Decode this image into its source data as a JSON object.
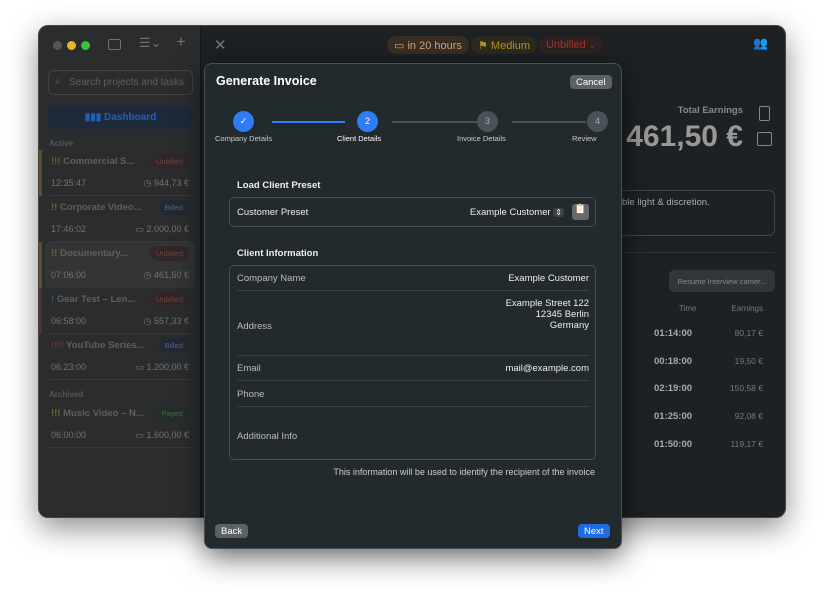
{
  "sidebar": {
    "search_placeholder": "Search projects and tasks",
    "dashboard_label": "Dashboard",
    "active_label": "Active",
    "archived_label": "Archived",
    "items": [
      {
        "priority": "!!!",
        "title": "Commercial S...",
        "status": "Unbilled",
        "time": "12:35:47",
        "amount": "944,73 €",
        "accent": "#8a6d1f"
      },
      {
        "priority": "!!",
        "title": "Corporate Video...",
        "status": "Billed",
        "time": "17:46:02",
        "amount": "2.000,00 €",
        "accent": ""
      },
      {
        "priority": "!!",
        "title": "Documentary...",
        "status": "Unbilled",
        "time": "07:06:00",
        "amount": "461,50 €",
        "accent": "#8a6d1f"
      },
      {
        "priority": "!",
        "title": "Gear Test – Len...",
        "status": "Unbilled",
        "time": "06:58:00",
        "amount": "557,33 €",
        "accent": "#8a2a2a"
      },
      {
        "priority": "!!!!",
        "title": "YouTube Series...",
        "status": "Billed",
        "time": "06:23:00",
        "amount": "1.200,00 €",
        "accent": ""
      }
    ],
    "archived": [
      {
        "priority": "!!!",
        "title": "Music Video – N...",
        "status": "Payed",
        "time": "06:00:00",
        "amount": "1.600,00 €"
      }
    ]
  },
  "header": {
    "due": "in 20 hours",
    "priority": "Medium",
    "status": "Unbilled"
  },
  "detail": {
    "total_label": "Total Earnings",
    "total_value": "461,50 €",
    "description": "ble light & discretion.",
    "resume_button": "Resume Interview camer...",
    "col_time": "Time",
    "col_earnings": "Earnings",
    "rows": [
      {
        "time": "01:14:00",
        "earn": "80,17 €"
      },
      {
        "time": "00:18:00",
        "earn": "19,50 €"
      },
      {
        "time": "02:19:00",
        "earn": "150,58 €"
      },
      {
        "time": "01:25:00",
        "earn": "92,08 €"
      },
      {
        "time": "01:50:00",
        "earn": "119,17 €"
      }
    ]
  },
  "modal": {
    "title": "Generate Invoice",
    "cancel": "Cancel",
    "steps": [
      {
        "num": "✓",
        "label": "Company Details"
      },
      {
        "num": "2",
        "label": "Client Details"
      },
      {
        "num": "3",
        "label": "Invoice Details"
      },
      {
        "num": "4",
        "label": "Review"
      }
    ],
    "preset_heading": "Load Client Preset",
    "preset_label": "Customer Preset",
    "preset_value": "Example Customer",
    "client_heading": "Client Information",
    "company_label": "Company Name",
    "company_value": "Example Customer",
    "address_label": "Address",
    "address_line1": "Example Street 122",
    "address_line2": "12345 Berlin",
    "address_line3": "Germany",
    "email_label": "Email",
    "email_value": "mail@example.com",
    "phone_label": "Phone",
    "phone_value": "",
    "info_label": "Additional Info",
    "info_value": "",
    "hint": "This information will be used to identify the recipient of the invoice",
    "back": "Back",
    "next": "Next"
  },
  "colors": {
    "accent": "#2f7cf6",
    "unbilled": "#c0392b",
    "billed": "#3b6fb5",
    "payed": "#3f8f4f",
    "medium": "#c9a227"
  }
}
